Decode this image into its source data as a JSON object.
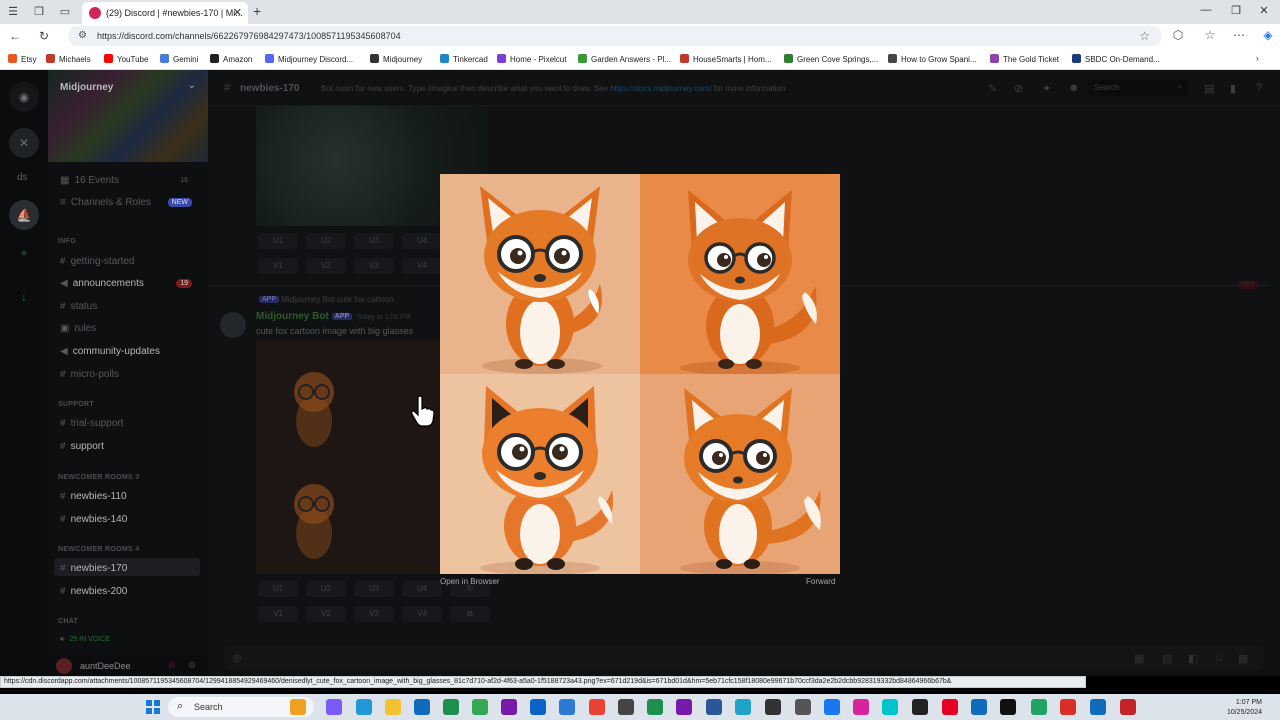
{
  "browser": {
    "tab_title": "(29) Discord | #newbies-170 | Mi...",
    "url": "https://discord.com/channels/662267976984297473/1008571195345608704",
    "bookmarks": [
      {
        "label": "Etsy",
        "color": "#e8571c"
      },
      {
        "label": "Michaels",
        "color": "#c0392b"
      },
      {
        "label": "YouTube",
        "color": "#ff0000"
      },
      {
        "label": "Gemini",
        "color": "#4a7bd8"
      },
      {
        "label": "Amazon",
        "color": "#222222"
      },
      {
        "label": "Midjourney Discord...",
        "color": "#5865f2"
      },
      {
        "label": "Midjourney",
        "color": "#333333"
      },
      {
        "label": "Tinkercad",
        "color": "#1e88c9"
      },
      {
        "label": "Home - Pixelcut",
        "color": "#7a3fd6"
      },
      {
        "label": "Garden Answers - Pl...",
        "color": "#3a9a3a"
      },
      {
        "label": "HouseSmarts | Hom...",
        "color": "#c0392b"
      },
      {
        "label": "Green Cove Springs,...",
        "color": "#2e7d32"
      },
      {
        "label": "How to Grow Spani...",
        "color": "#444444"
      },
      {
        "label": "The Gold Ticket",
        "color": "#8e44ad"
      },
      {
        "label": "SBDC On-Demand...",
        "color": "#1a3a7a"
      }
    ],
    "status_url": "https://cdn.discordapp.com/attachments/1008571195345608704/1299418854929469460/denisedlyt_cute_fox_cartoon_image_with_big_glasses_81c7d710-af2d-4f63-a5a0-1f5188723a43.png?ex=671d219d&is=671bd01d&hm=5eb71cfc158f18080e99671b70ccf3da2e2b2dcbb928319332bd84864966b67b&"
  },
  "server": {
    "name": "Midjourney",
    "rail_label": "ds"
  },
  "channels": {
    "events": {
      "label": "16 Events",
      "count": "16"
    },
    "channels_roles": {
      "label": "Channels & Roles",
      "badge": "NEW"
    },
    "cat_info": "INFO",
    "getting_started": "getting-started",
    "announcements": {
      "label": "announcements",
      "count": "19"
    },
    "status": "status",
    "rules": "rules",
    "community_updates": "community-updates",
    "micro_polls": "micro-polls",
    "cat_support": "SUPPORT",
    "trial_support": "trial-support",
    "support": "support",
    "cat_newcomer3": "NEWCOMER ROOMS 3",
    "newbies_110": "newbies-110",
    "newbies_140": "newbies-140",
    "cat_newcomer4": "NEWCOMER ROOMS 4",
    "newbies_170": "newbies-170",
    "newbies_200": "newbies-200",
    "cat_chat": "CHAT",
    "voice": "25 IN VOICE"
  },
  "user": {
    "name": "auntDeeDee"
  },
  "header": {
    "channel": "newbies-170",
    "topic_prefix": "Bot room for new users. Type /imagine then describe what you want to draw. See",
    "topic_link": "https://docs.midjourney.com/",
    "topic_suffix": "for more information",
    "search_placeholder": "Search"
  },
  "message": {
    "reference": "Midjourney Bot  cute fox cartoon",
    "app_tag": "APP",
    "author": "Midjourney Bot",
    "time": "Today at 1:06 PM",
    "text": "cute fox cartoon image with big glasses",
    "new_tag": "NEW"
  },
  "buttons_top": {
    "u1": "U1",
    "u2": "U2",
    "u3": "U3",
    "u4": "U4",
    "v1": "V1",
    "v2": "V2",
    "v3": "V3",
    "v4": "V4"
  },
  "buttons_bottom": {
    "u1": "U1",
    "u2": "U2",
    "u3": "U3",
    "u4": "U4",
    "v1": "V1",
    "v2": "V2",
    "v3": "V3",
    "v4": "V4"
  },
  "viewer": {
    "open_in_browser": "Open in Browser",
    "forward": "Forward"
  },
  "taskbar": {
    "search": "Search",
    "time": "1:07 PM",
    "date": "10/25/2024"
  }
}
